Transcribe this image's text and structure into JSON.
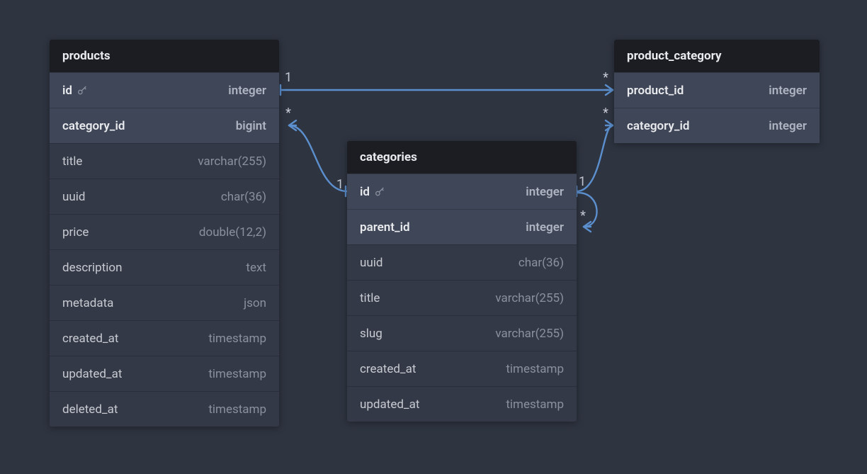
{
  "colors": {
    "background": "#2e3440",
    "header": "#1b1d23",
    "row": "#333947",
    "rowHighlight": "#3f4657",
    "wire": "#5b8fce"
  },
  "tables": {
    "products": {
      "title": "products",
      "columns": [
        {
          "name": "id",
          "type": "integer",
          "pk": true,
          "highlight": true
        },
        {
          "name": "category_id",
          "type": "bigint",
          "pk": false,
          "highlight": true
        },
        {
          "name": "title",
          "type": "varchar(255)",
          "pk": false,
          "highlight": false
        },
        {
          "name": "uuid",
          "type": "char(36)",
          "pk": false,
          "highlight": false
        },
        {
          "name": "price",
          "type": "double(12,2)",
          "pk": false,
          "highlight": false
        },
        {
          "name": "description",
          "type": "text",
          "pk": false,
          "highlight": false
        },
        {
          "name": "metadata",
          "type": "json",
          "pk": false,
          "highlight": false
        },
        {
          "name": "created_at",
          "type": "timestamp",
          "pk": false,
          "highlight": false
        },
        {
          "name": "updated_at",
          "type": "timestamp",
          "pk": false,
          "highlight": false
        },
        {
          "name": "deleted_at",
          "type": "timestamp",
          "pk": false,
          "highlight": false
        }
      ]
    },
    "categories": {
      "title": "categories",
      "columns": [
        {
          "name": "id",
          "type": "integer",
          "pk": true,
          "highlight": true
        },
        {
          "name": "parent_id",
          "type": "integer",
          "pk": false,
          "highlight": true
        },
        {
          "name": "uuid",
          "type": "char(36)",
          "pk": false,
          "highlight": false
        },
        {
          "name": "title",
          "type": "varchar(255)",
          "pk": false,
          "highlight": false
        },
        {
          "name": "slug",
          "type": "varchar(255)",
          "pk": false,
          "highlight": false
        },
        {
          "name": "created_at",
          "type": "timestamp",
          "pk": false,
          "highlight": false
        },
        {
          "name": "updated_at",
          "type": "timestamp",
          "pk": false,
          "highlight": false
        }
      ]
    },
    "product_category": {
      "title": "product_category",
      "columns": [
        {
          "name": "product_id",
          "type": "integer",
          "pk": false,
          "highlight": true
        },
        {
          "name": "category_id",
          "type": "integer",
          "pk": false,
          "highlight": true
        }
      ]
    }
  },
  "relationships": [
    {
      "from": "products.id",
      "to": "product_category.product_id",
      "from_card": "1",
      "to_card": "*"
    },
    {
      "from": "products.category_id",
      "to": "categories.id",
      "from_card": "*",
      "to_card": "1"
    },
    {
      "from": "categories.id",
      "to": "product_category.category_id",
      "from_card": "1",
      "to_card": "*"
    },
    {
      "from": "categories.id",
      "to": "categories.parent_id",
      "from_card": "1",
      "to_card": "*"
    }
  ],
  "cardinality_labels": {
    "a": "1",
    "b": "*",
    "c": "*",
    "d": "1",
    "e": "1",
    "f": "*",
    "g": "*"
  }
}
